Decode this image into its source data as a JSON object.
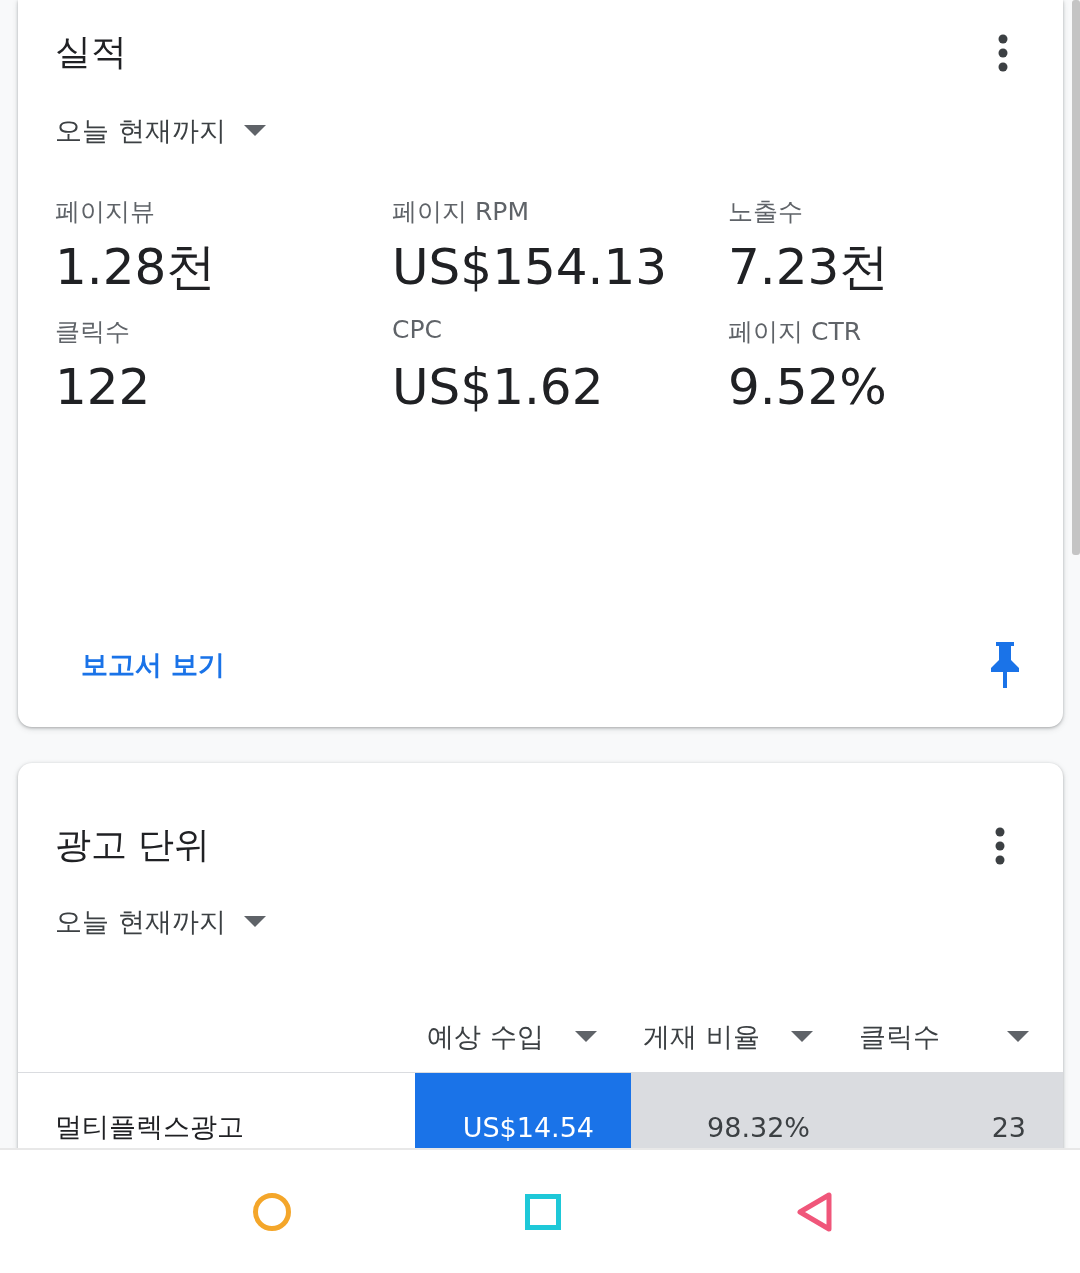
{
  "performance": {
    "title": "실적",
    "range": "오늘 현재까지",
    "metrics": [
      {
        "label": "페이지뷰",
        "value": "1.28천"
      },
      {
        "label": "페이지 RPM",
        "value": "US$154.13"
      },
      {
        "label": "노출수",
        "value": "7.23천"
      },
      {
        "label": "클릭수",
        "value": "122"
      },
      {
        "label": "CPC",
        "value": "US$1.62"
      },
      {
        "label": "페이지 CTR",
        "value": "9.52%"
      }
    ],
    "report_link": "보고서 보기"
  },
  "ad_units": {
    "title": "광고 단위",
    "range": "오늘 현재까지",
    "columns": [
      {
        "label": "예상 수입",
        "selected": true
      },
      {
        "label": "게재 비율",
        "selected": false
      },
      {
        "label": "클릭수",
        "selected": false
      }
    ],
    "rows": [
      {
        "name": "멀티플렉스광고",
        "cells": [
          "US$14.54",
          "98.32%",
          "23"
        ]
      }
    ]
  }
}
